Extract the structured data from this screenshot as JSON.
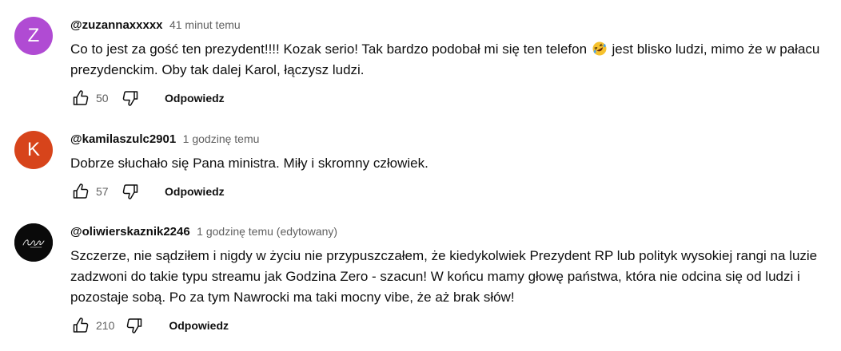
{
  "comments": [
    {
      "author": "@zuzannaxxxxx",
      "time": "41 minut temu",
      "avatar_letter": "Z",
      "avatar_color": "#b04bd3",
      "text_before_emoji": "Co to jest za gość ten prezydent!!!! Kozak serio! Tak bardzo podobał mi się ten telefon",
      "emoji": "rolling-on-floor-laughing",
      "text_after_emoji": "jest blisko ludzi, mimo że w pałacu prezydenckim. Oby tak dalej Karol, łączysz ludzi.",
      "likes": "50",
      "reply_label": "Odpowiedz"
    },
    {
      "author": "@kamilaszulc2901",
      "time": "1 godzinę temu",
      "avatar_letter": "K",
      "avatar_color": "#d7441b",
      "text": "Dobrze słuchało się Pana ministra. Miły i skromny człowiek.",
      "likes": "57",
      "reply_label": "Odpowiedz"
    },
    {
      "author": "@oliwierskaznik2246",
      "time": "1 godzinę temu (edytowany)",
      "avatar_image": "signature-logo",
      "text": "Szczerze, nie sądziłem i nigdy w życiu nie przypuszczałem, że kiedykolwiek Prezydent RP lub polityk wysokiej rangi na luzie zadzwoni do takie typu streamu jak Godzina Zero - szacun! W końcu mamy głowę państwa, która nie odcina się od ludzi i pozostaje sobą. Po za tym Nawrocki ma taki mocny vibe, że aż brak słów!",
      "likes": "210",
      "reply_label": "Odpowiedz"
    }
  ]
}
